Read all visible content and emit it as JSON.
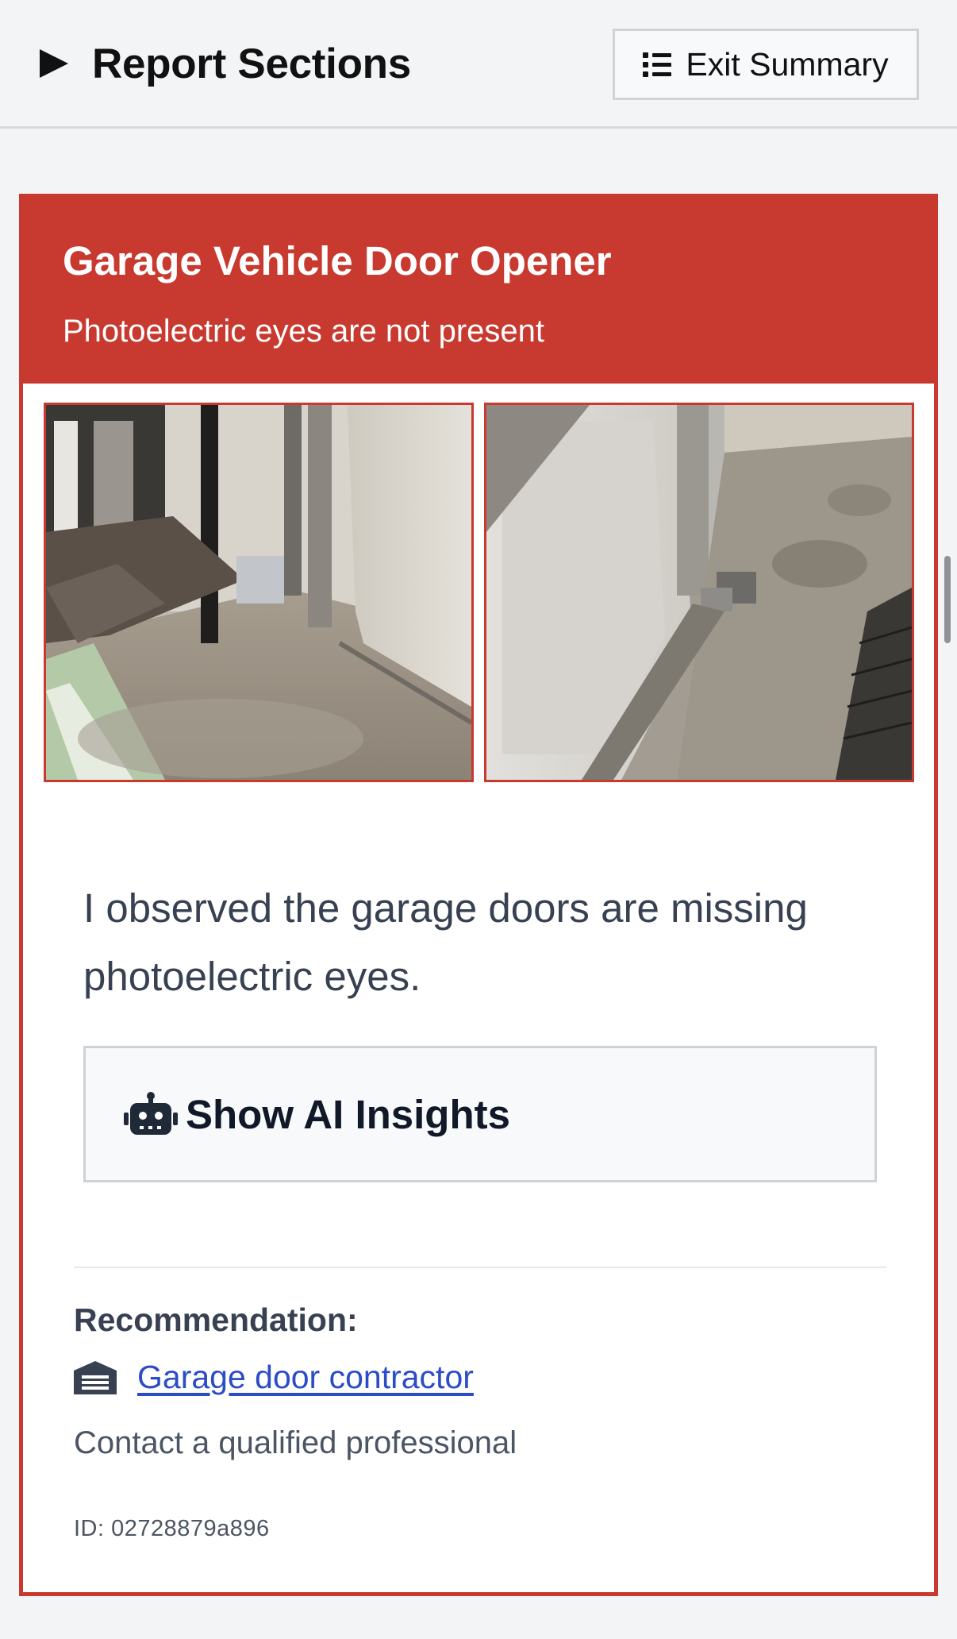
{
  "header": {
    "sections_title": "Report Sections",
    "exit_label": "Exit Summary"
  },
  "finding": {
    "title": "Garage Vehicle Door Opener",
    "subtitle": "Photoelectric eyes are not present",
    "observation": "I observed the garage doors are missing photoelectric eyes.",
    "ai_button_label": "Show AI Insights",
    "recommendation_label": "Recommendation:",
    "contractor": "Garage door contractor",
    "contact": "Contact a qualified professional",
    "id": "ID: 02728879a896"
  },
  "icons": {
    "sections_toggle": "play-triangle-icon",
    "exit": "list-icon",
    "ai": "robot-icon",
    "contractor": "garage-icon"
  },
  "colors": {
    "accent_red": "#c8392f",
    "link_blue": "#2b4cc5",
    "background": "#f3f4f6"
  }
}
